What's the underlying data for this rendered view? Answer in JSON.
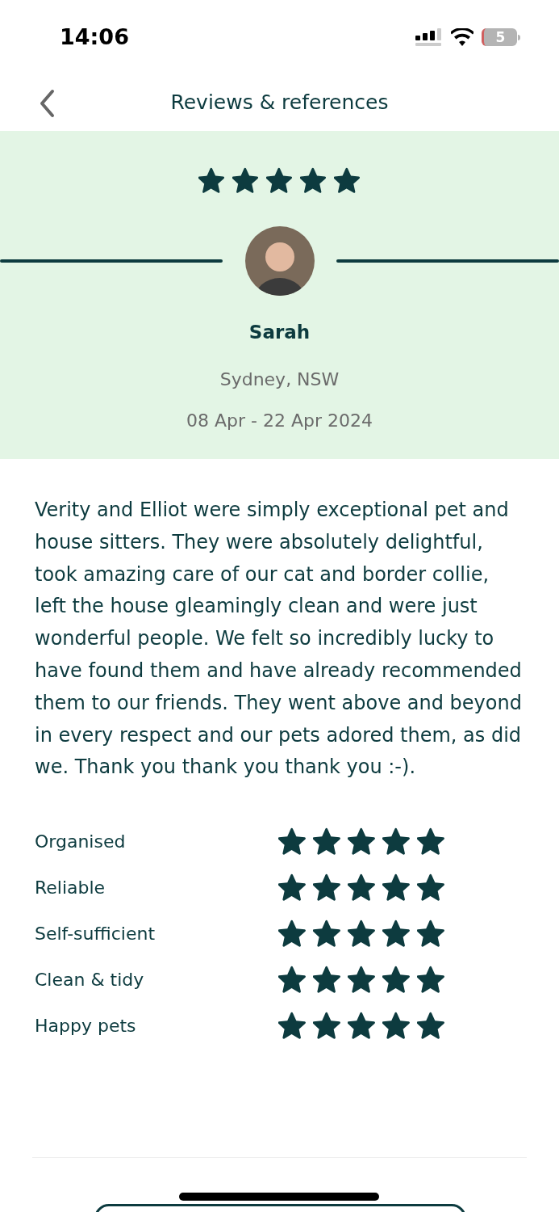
{
  "status_bar": {
    "time": "14:06",
    "battery": "5"
  },
  "header": {
    "title": "Reviews & references"
  },
  "review": {
    "stars": 5,
    "name": "Sarah",
    "location": "Sydney, NSW",
    "dates": "08 Apr - 22 Apr 2024",
    "text": "Verity and Elliot were simply exceptional pet and house sitters. They were absolutely delightful, took amazing care of our cat and border collie, left the house gleamingly clean and were just wonderful people. We felt so incredibly lucky to have found them and have already recommended them to our friends. They went above and beyond in every respect and our pets adored them, as did we. Thank you thank you thank you :-)."
  },
  "ratings": [
    {
      "label": "Organised",
      "stars": 5
    },
    {
      "label": "Reliable",
      "stars": 5
    },
    {
      "label": "Self-sufficient",
      "stars": 5
    },
    {
      "label": "Clean & tidy",
      "stars": 5
    },
    {
      "label": "Happy pets",
      "stars": 5
    }
  ]
}
